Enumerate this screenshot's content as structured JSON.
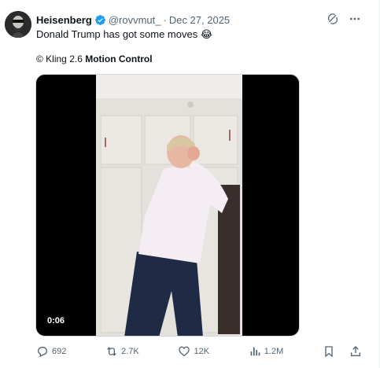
{
  "post": {
    "author_name": "Heisenberg",
    "handle": "@rovvmut_",
    "separator": "·",
    "date": "Dec 27, 2025",
    "text": "Donald Trump has got some moves 😂",
    "credit_prefix": "© Kling 2.6 ",
    "credit_bold": "Motion Control",
    "verified": true
  },
  "media": {
    "duration": "0:06"
  },
  "actions": {
    "replies": "692",
    "reposts": "2.7K",
    "likes": "12K",
    "views": "1.2M"
  },
  "colors": {
    "text": "#0f1419",
    "secondary": "#536471",
    "verified": "#1d9bf0",
    "shirt": "#f4eef4",
    "trousers": "#1f2a44"
  },
  "icons": [
    "grok-icon",
    "more-icon",
    "reply-icon",
    "repost-icon",
    "like-icon",
    "views-icon",
    "bookmark-icon",
    "share-icon",
    "verified-badge-icon"
  ]
}
